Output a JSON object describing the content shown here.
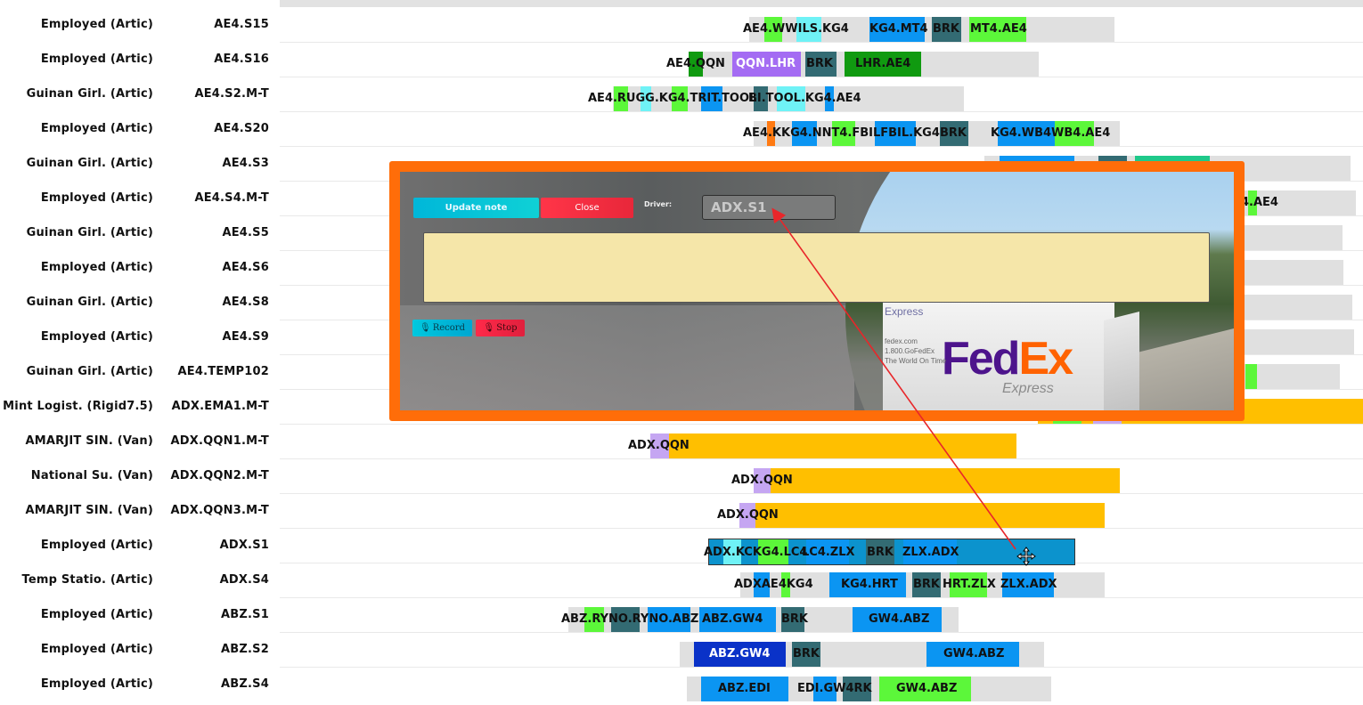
{
  "rows": [
    {
      "driver": "Employed (Artic)",
      "code": "AE4.S15"
    },
    {
      "driver": "Employed (Artic)",
      "code": "AE4.S16"
    },
    {
      "driver": "Guinan Girl. (Artic)",
      "code": "AE4.S2.M-T"
    },
    {
      "driver": "Employed (Artic)",
      "code": "AE4.S20"
    },
    {
      "driver": "Guinan Girl. (Artic)",
      "code": "AE4.S3"
    },
    {
      "driver": "Employed (Artic)",
      "code": "AE4.S4.M-T"
    },
    {
      "driver": "Guinan Girl. (Artic)",
      "code": "AE4.S5"
    },
    {
      "driver": "Employed (Artic)",
      "code": "AE4.S6"
    },
    {
      "driver": "Guinan Girl. (Artic)",
      "code": "AE4.S8"
    },
    {
      "driver": "Employed (Artic)",
      "code": "AE4.S9"
    },
    {
      "driver": "Guinan Girl. (Artic)",
      "code": "AE4.TEMP102"
    },
    {
      "driver": "Mint Logist. (Rigid7.5)",
      "code": "ADX.EMA1.M-T"
    },
    {
      "driver": "AMARJIT SIN. (Van)",
      "code": "ADX.QQN1.M-T"
    },
    {
      "driver": "National Su. (Van)",
      "code": "ADX.QQN2.M-T"
    },
    {
      "driver": "AMARJIT SIN. (Van)",
      "code": "ADX.QQN3.M-T"
    },
    {
      "driver": "Employed (Artic)",
      "code": "ADX.S1"
    },
    {
      "driver": "Temp Statio. (Artic)",
      "code": "ADX.S4"
    },
    {
      "driver": "Employed (Artic)",
      "code": "ABZ.S1"
    },
    {
      "driver": "Employed (Artic)",
      "code": "ABZ.S2"
    },
    {
      "driver": "Employed (Artic)",
      "code": "ABZ.S4"
    }
  ],
  "trips": {
    "r0": [
      "AE4.WWILS.KG4",
      "KG4.MT4",
      "BRK",
      "MT4.AE4"
    ],
    "r1": [
      "AE4.QQN",
      "QQN.LHR",
      "BRK",
      "LHR.AE4"
    ],
    "r2": [
      "AE4.RUGG.KG4.TRIT.TOOL",
      "BI.TOOL.KG4.AE4"
    ],
    "r3": [
      "AE4.KKG4.NNT4.FBILFBIL.KG4",
      "BRK",
      "KG4.WB4WB4.AE4"
    ],
    "r5": [
      "4.AE4"
    ],
    "r12": [
      "ADX.QQN"
    ],
    "r13": [
      "ADX.QQN"
    ],
    "r14": [
      "ADX.QQN"
    ],
    "r15": [
      "ADX.KCKG4.LC4",
      "LC4.ZLX",
      "BRK",
      "ZLX.ADX"
    ],
    "r16": [
      "ADXAE4KG4",
      "KG4.HRT",
      "BRK",
      "HRT.ZLX",
      "ZLX.ADX"
    ],
    "r17": [
      "ABZ.RYNO.RYNO.ABZ",
      "ABZ.GW4",
      "BRK",
      "GW4.ABZ"
    ],
    "r18": [
      "ABZ.GW4",
      "BRK",
      "GW4.ABZ"
    ],
    "r19": [
      "ABZ.EDI",
      "EDI.GW4RK",
      "GW4.ABZ"
    ]
  },
  "modal": {
    "update_label": "Update note",
    "close_label": "Close",
    "driver_label": "Driver:",
    "driver_value": "ADX.S1",
    "note_value": "",
    "record_label": "Record",
    "stop_label": "Stop",
    "photo_text": {
      "express_top": "Express",
      "brand_a": "Fed",
      "brand_b": "Ex",
      "express_bottom": "Express",
      "site": "fedex.com",
      "phone": "1.800.GoFedEx",
      "tagline": "The World On Time"
    }
  },
  "colors": {
    "modal_border": "#ff6d09",
    "selected_bar": "#0c93cd",
    "amber": "#ffbf00",
    "break": "#336b73",
    "arrow": "#e8262a"
  },
  "icons": [
    "mic-icon",
    "move-cursor-icon"
  ]
}
